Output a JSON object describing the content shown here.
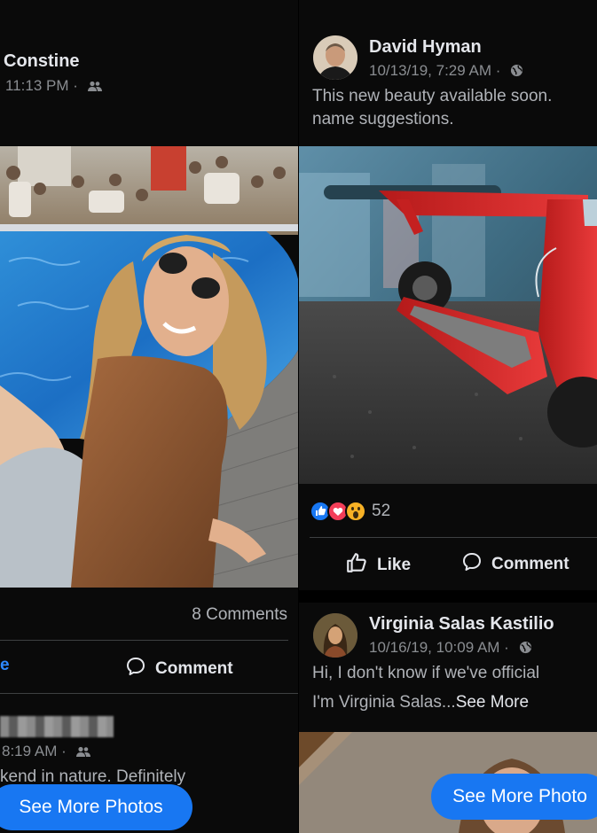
{
  "left_post": {
    "author": "Constine",
    "time": "11:13 PM ·",
    "audience_icon": "friends-icon",
    "comments_count": "8 Comments",
    "like_partial": "e",
    "comment_label": "Comment",
    "next_post": {
      "time": "8:19 AM ·",
      "audience_icon": "friends-icon",
      "text": "kend in nature. Definitely"
    },
    "see_more_photos": "See More Photos"
  },
  "right_post": {
    "author": "David Hyman",
    "time": "10/13/19, 7:29 AM ·",
    "audience_icon": "globe-icon",
    "text_line1": "This new beauty available soon.",
    "text_line2": "name suggestions.",
    "reactions": [
      "like-reaction-icon",
      "love-reaction-icon",
      "wow-reaction-icon"
    ],
    "reaction_count": "52",
    "like_label": "Like",
    "comment_label": "Comment",
    "next_post": {
      "author": "Virginia Salas Kastilio",
      "time": "10/16/19, 10:09 AM ·",
      "audience_icon": "globe-icon",
      "text_line1": "Hi, I don't know if we've official",
      "text_line2": "I'm Virginia Salas...",
      "see_more": "See More"
    },
    "see_more_photos": "See More Photo"
  },
  "colors": {
    "background": "#0a0a0a",
    "accent": "#1877f2",
    "text_primary": "#e4e6eb",
    "text_secondary": "#8a8d91"
  }
}
